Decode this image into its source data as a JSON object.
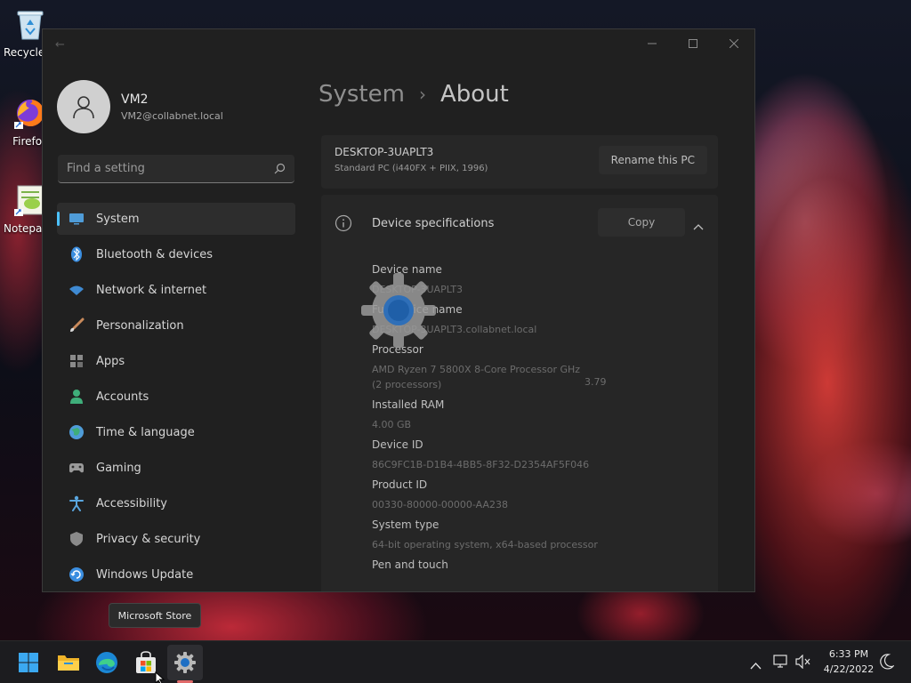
{
  "desktop": {
    "icons": [
      {
        "label": "Recycle Bin",
        "icon": "recycle-bin-icon"
      },
      {
        "label": "Firefox",
        "icon": "firefox-icon"
      },
      {
        "label": "Notepad++",
        "icon": "notepad-icon"
      }
    ]
  },
  "settings": {
    "user": {
      "name": "VM2",
      "email": "VM2@collabnet.local"
    },
    "search": {
      "placeholder": "Find a setting"
    },
    "nav": [
      {
        "label": "System",
        "icon": "system-icon",
        "color": "#4f9cd8",
        "active": true
      },
      {
        "label": "Bluetooth & devices",
        "icon": "bluetooth-icon",
        "color": "#3b8ee0"
      },
      {
        "label": "Network & internet",
        "icon": "network-icon",
        "color": "#3f8ad2"
      },
      {
        "label": "Personalization",
        "icon": "brush-icon",
        "color": "#c98a5b"
      },
      {
        "label": "Apps",
        "icon": "apps-icon",
        "color": "#8a8a8a"
      },
      {
        "label": "Accounts",
        "icon": "accounts-icon",
        "color": "#3fae7a"
      },
      {
        "label": "Time & language",
        "icon": "globe-icon",
        "color": "#4f9cd8"
      },
      {
        "label": "Gaming",
        "icon": "gaming-icon",
        "color": "#9a9a9a"
      },
      {
        "label": "Accessibility",
        "icon": "accessibility-icon",
        "color": "#5aa7e0"
      },
      {
        "label": "Privacy & security",
        "icon": "shield-icon",
        "color": "#8a8a8a"
      },
      {
        "label": "Windows Update",
        "icon": "update-icon",
        "color": "#3b8ee0"
      }
    ],
    "breadcrumb": {
      "parent": "System",
      "current": "About"
    },
    "pc": {
      "name": "DESKTOP-3UAPLT3",
      "model": "Standard PC (i440FX + PIIX, 1996)",
      "rename_label": "Rename this PC"
    },
    "device_specs": {
      "title": "Device specifications",
      "copy_label": "Copy",
      "items": [
        {
          "label": "Device name",
          "value": "DESKTOP-3UAPLT3"
        },
        {
          "label": "Full device name",
          "value": "DESKTOP-3UAPLT3.collabnet.local"
        },
        {
          "label": "Processor",
          "value": "AMD Ryzen 7 5800X 8-Core Processor GHz  (2 processors)"
        },
        {
          "label": "Installed RAM",
          "value": "4.00 GB"
        },
        {
          "label": "Device ID",
          "value": "86C9FC1B-D1B4-4BB5-8F32-D2354AF5F046"
        },
        {
          "label": "Product ID",
          "value": "00330-80000-00000-AA238"
        },
        {
          "label": "System type",
          "value": "64-bit operating system, x64-based processor"
        },
        {
          "label": "Pen and touch",
          "value": ""
        }
      ],
      "processor_speed": "3.79"
    }
  },
  "tooltip": {
    "text": "Microsoft Store"
  },
  "taskbar": {
    "apps": [
      {
        "name": "start-button",
        "icon": "windows-logo-icon"
      },
      {
        "name": "file-explorer-button",
        "icon": "folder-icon"
      },
      {
        "name": "edge-button",
        "icon": "edge-icon"
      },
      {
        "name": "store-button",
        "icon": "store-icon"
      },
      {
        "name": "settings-button",
        "icon": "gear-icon",
        "active": true
      }
    ],
    "clock": {
      "time": "6:33 PM",
      "date": "4/22/2022"
    }
  },
  "colors": {
    "accent": "#4cc2ff",
    "window_bg": "#202020",
    "card_bg": "#272727",
    "taskbar_bg": "#1c1c1f"
  }
}
